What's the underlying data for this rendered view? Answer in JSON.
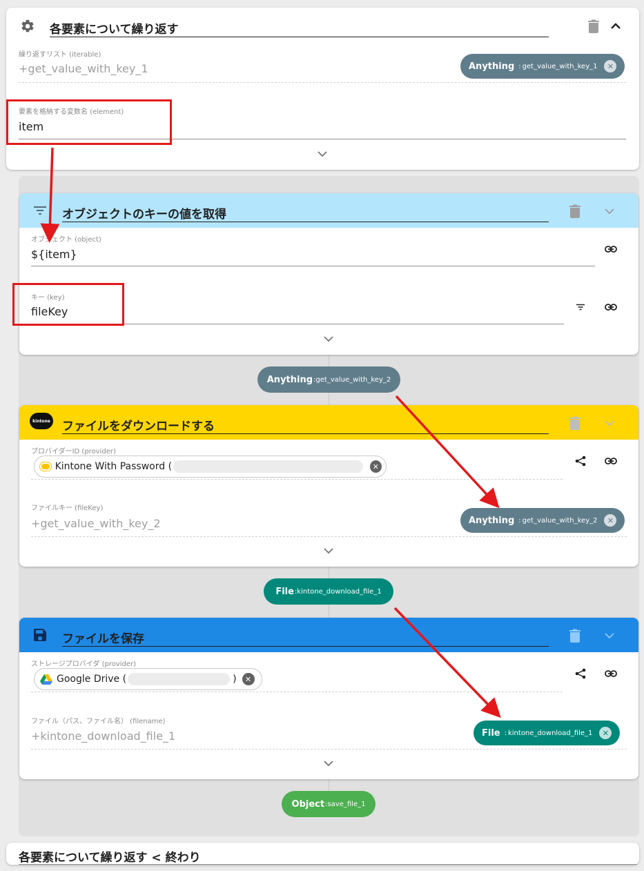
{
  "loop_block": {
    "title": "各要素について繰り返す",
    "iterable_label": "繰り返すリスト (iterable)",
    "iterable_placeholder": "+get_value_with_key_1",
    "iterable_chip": {
      "type": "Anything",
      "sep": ":",
      "name": "get_value_with_key_1"
    },
    "element_label": "要素を格納する変数名 (element)",
    "element_value": "item"
  },
  "get_key_block": {
    "title": "オブジェクトのキーの値を取得",
    "header_color": "#b3e5fc",
    "object_label": "オブジェクト (object)",
    "object_value": "${item}",
    "key_label": "キー (key)",
    "key_value": "fileKey",
    "output": {
      "type": "Anything",
      "sep": ":",
      "name": "get_value_with_key_2"
    }
  },
  "download_block": {
    "title": "ファイルをダウンロードする",
    "header_color": "#ffd600",
    "logo_text": "kintone",
    "provider_label": "プロバイダーID (provider)",
    "provider_value": "Kintone With Password (",
    "filekey_label": "ファイルキー (fileKey)",
    "filekey_placeholder": "+get_value_with_key_2",
    "filekey_chip": {
      "type": "Anything",
      "sep": ":",
      "name": "get_value_with_key_2"
    },
    "output": {
      "type": "File",
      "sep": ":",
      "name": "kintone_download_file_1"
    }
  },
  "save_block": {
    "title": "ファイルを保存",
    "header_color": "#1e88e5",
    "provider_label": "ストレージプロバイダ (provider)",
    "provider_value": "Google Drive (",
    "provider_close": ")",
    "filename_label": "ファイル（パス、ファイル名） (filename)",
    "filename_placeholder": "+kintone_download_file_1",
    "filename_chip": {
      "type": "File",
      "sep": ":",
      "name": "kintone_download_file_1"
    },
    "output": {
      "type": "Object",
      "sep": ":",
      "name": "save_file_1"
    }
  },
  "loop_end": {
    "title": "各要素について繰り返す < 終わり"
  },
  "colors": {
    "anything_chip": "#607d8b",
    "file_chip": "#00897b",
    "object_chip": "#4caf50",
    "annotation_red": "#e3191b"
  }
}
